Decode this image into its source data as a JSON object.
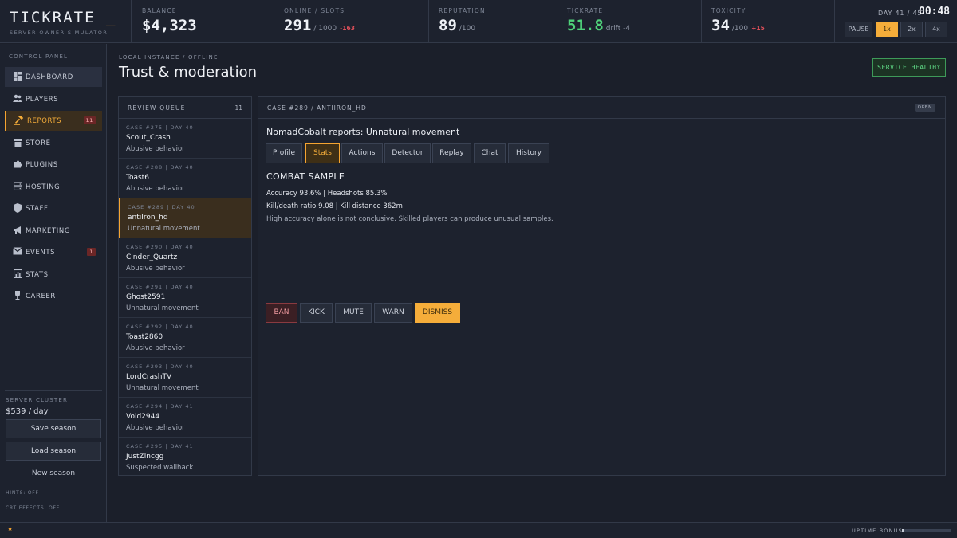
{
  "brand": {
    "title": "TICKRATE",
    "cursor": "_",
    "subtitle": "SERVER OWNER SIMULATOR"
  },
  "stats": {
    "balance": {
      "label": "BALANCE",
      "value": "$4,323"
    },
    "online": {
      "label": "ONLINE / SLOTS",
      "value": "291",
      "slots": "/ 1000",
      "delta": "-163"
    },
    "reputation": {
      "label": "REPUTATION",
      "value": "89",
      "max": "/100"
    },
    "tickrate": {
      "label": "TICKRATE",
      "value": "51.8",
      "drift": "drift -4"
    },
    "toxicity": {
      "label": "TOXICITY",
      "value": "34",
      "max": "/100",
      "delta": "+15"
    }
  },
  "clock": {
    "day": "DAY 41 / 45",
    "time": "00:48",
    "speeds": [
      "PAUSE",
      "1x",
      "2x",
      "4x"
    ],
    "active_speed": "1x"
  },
  "sidebar": {
    "label": "CONTROL PANEL",
    "items": [
      {
        "label": "DASHBOARD",
        "icon": "dashboard-icon"
      },
      {
        "label": "PLAYERS",
        "icon": "players-icon"
      },
      {
        "label": "REPORTS",
        "icon": "gavel-icon",
        "badge": "11"
      },
      {
        "label": "STORE",
        "icon": "store-icon"
      },
      {
        "label": "PLUGINS",
        "icon": "puzzle-icon"
      },
      {
        "label": "HOSTING",
        "icon": "server-icon"
      },
      {
        "label": "STAFF",
        "icon": "shield-icon"
      },
      {
        "label": "MARKETING",
        "icon": "megaphone-icon"
      },
      {
        "label": "EVENTS",
        "icon": "mail-icon",
        "badge": "1"
      },
      {
        "label": "STATS",
        "icon": "chart-icon"
      },
      {
        "label": "CAREER",
        "icon": "trophy-icon"
      }
    ],
    "cluster_label": "SERVER CLUSTER",
    "cluster_value": "$539 / day",
    "save_label": "Save season",
    "load_label": "Load season",
    "new_label": "New season",
    "hints": "HINTS: OFF",
    "crt": "CRT EFFECTS: OFF"
  },
  "main": {
    "breadcrumb": "LOCAL INSTANCE / OFFLINE",
    "title": "Trust & moderation",
    "health": "SERVICE HEALTHY"
  },
  "queue": {
    "title": "REVIEW QUEUE",
    "count": "11",
    "items": [
      {
        "meta": "CASE #275 | DAY 40",
        "name": "Scout_Crash",
        "reason": "Abusive behavior"
      },
      {
        "meta": "CASE #288 | DAY 40",
        "name": "Toast6",
        "reason": "Abusive behavior"
      },
      {
        "meta": "CASE #289 | DAY 40",
        "name": "antiIron_hd",
        "reason": "Unnatural movement"
      },
      {
        "meta": "CASE #290 | DAY 40",
        "name": "Cinder_Quartz",
        "reason": "Abusive behavior"
      },
      {
        "meta": "CASE #291 | DAY 40",
        "name": "Ghost2591",
        "reason": "Unnatural movement"
      },
      {
        "meta": "CASE #292 | DAY 40",
        "name": "Toast2860",
        "reason": "Abusive behavior"
      },
      {
        "meta": "CASE #293 | DAY 40",
        "name": "LordCrashTV",
        "reason": "Unnatural movement"
      },
      {
        "meta": "CASE #294 | DAY 41",
        "name": "Void2944",
        "reason": "Abusive behavior"
      },
      {
        "meta": "CASE #295 | DAY 41",
        "name": "JustZincgg",
        "reason": "Suspected wallhack"
      }
    ]
  },
  "case": {
    "header": "CASE #289 / ANTIIRON_HD",
    "status": "OPEN",
    "title": "NomadCobalt reports: Unnatural movement",
    "tabs": [
      "Profile",
      "Stats",
      "Actions",
      "Detector",
      "Replay",
      "Chat",
      "History"
    ],
    "active_tab": "Stats",
    "section": "COMBAT SAMPLE",
    "line1": "Accuracy 93.6% | Headshots 85.3%",
    "line2": "Kill/death ratio 9.08 | Kill distance 362m",
    "note": "High accuracy alone is not conclusive. Skilled players can produce unusual samples.",
    "actions": [
      "BAN",
      "KICK",
      "MUTE",
      "WARN",
      "DISMISS"
    ]
  },
  "footer": {
    "star": "★",
    "uptime_label": "UPTIME BONUS",
    "uptime_fraction": 0.05
  }
}
